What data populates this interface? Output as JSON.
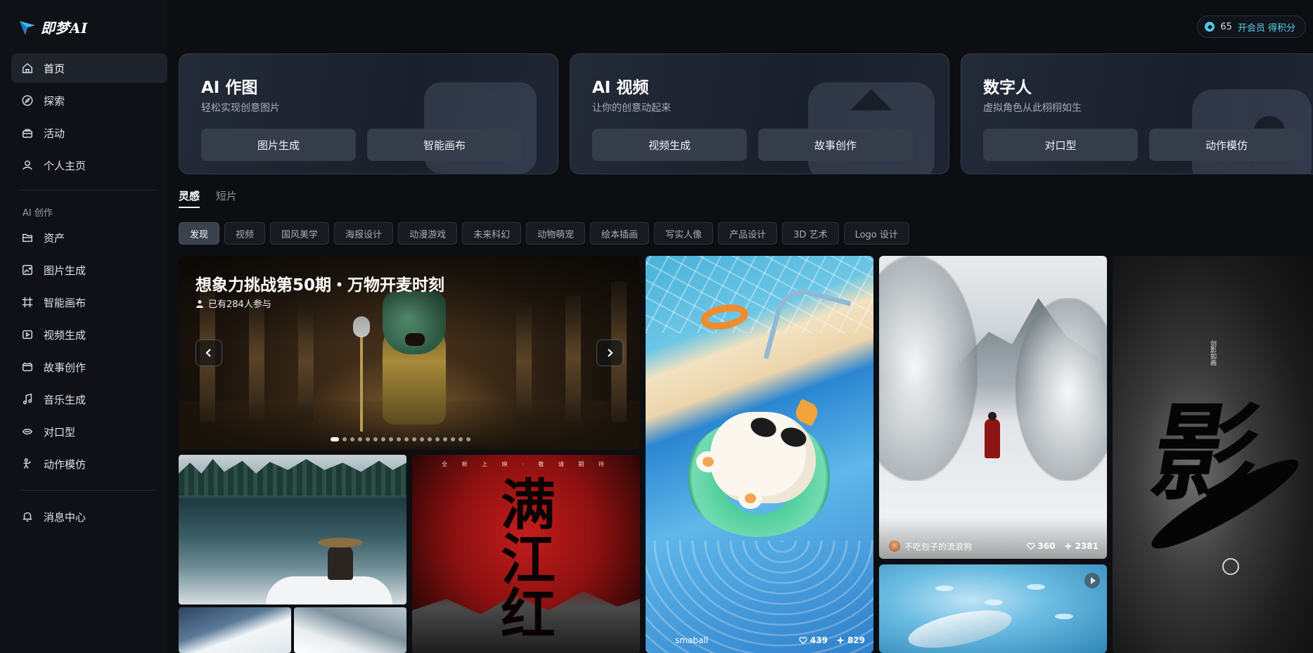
{
  "app": {
    "logo_text": "即梦AI"
  },
  "account": {
    "points": "65",
    "vip_text": "开会员 得积分"
  },
  "sidebar": {
    "main_items": [
      {
        "label": "首页",
        "icon": "home-icon",
        "active": true
      },
      {
        "label": "探索",
        "icon": "compass-icon"
      },
      {
        "label": "活动",
        "icon": "gift-icon"
      },
      {
        "label": "个人主页",
        "icon": "user-icon"
      }
    ],
    "section_label": "AI 创作",
    "create_items": [
      {
        "label": "资产",
        "icon": "folder-icon"
      },
      {
        "label": "图片生成",
        "icon": "image-gen-icon"
      },
      {
        "label": "智能画布",
        "icon": "canvas-icon"
      },
      {
        "label": "视频生成",
        "icon": "video-gen-icon"
      },
      {
        "label": "故事创作",
        "icon": "story-icon"
      },
      {
        "label": "音乐生成",
        "icon": "music-icon"
      },
      {
        "label": "对口型",
        "icon": "lipsync-icon"
      },
      {
        "label": "动作模仿",
        "icon": "motion-icon"
      }
    ],
    "bottom_items": [
      {
        "label": "消息中心",
        "icon": "bell-icon"
      }
    ]
  },
  "feature_cards": [
    {
      "title": "AI 作图",
      "subtitle": "轻松实现创意图片",
      "buttons": [
        "图片生成",
        "智能画布"
      ]
    },
    {
      "title": "AI 视频",
      "subtitle": "让你的创意动起来",
      "buttons": [
        "视频生成",
        "故事创作"
      ]
    },
    {
      "title": "数字人",
      "subtitle": "虚拟角色从此栩栩如生",
      "buttons": [
        "对口型",
        "动作模仿"
      ]
    }
  ],
  "tabs": [
    {
      "label": "灵感",
      "active": true
    },
    {
      "label": "短片",
      "active": false
    }
  ],
  "categories": [
    "发现",
    "视频",
    "国风美学",
    "海报设计",
    "动漫游戏",
    "未来科幻",
    "动物萌宠",
    "绘本插画",
    "写实人像",
    "产品设计",
    "3D 艺术",
    "Logo 设计"
  ],
  "active_category": "发现",
  "banner": {
    "title": "想象力挑战第50期・万物开麦时刻",
    "participants": "已有284人参与",
    "slide_count": 18,
    "active_slide": 1
  },
  "gallery": {
    "poster_top_text": "全 新 上 映 · 敬 请 期 待",
    "poster_calligraphy": "满江红",
    "ink_character": "影",
    "ink_small_text": "剑影如画",
    "items": [
      {
        "id": "snow",
        "author": "不吃包子的流浪狗",
        "likes": "360",
        "uses": "2381"
      },
      {
        "id": "pool",
        "author": "smaball",
        "likes": "439",
        "uses": "829"
      }
    ]
  }
}
